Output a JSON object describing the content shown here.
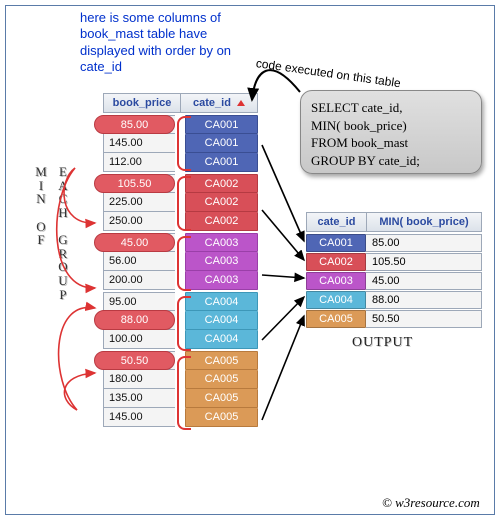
{
  "caption": "here is some columns of book_mast table have displayed with order by on cate_id",
  "curve_label": "code executed on this table",
  "sql": {
    "l1": "SELECT cate_id,",
    "l2": "MIN( book_price)",
    "l3": "FROM book_mast",
    "l4": "GROUP BY cate_id;"
  },
  "side_left": "MIN OF",
  "side_right": "EACH GROUP",
  "input_headers": {
    "book_price": "book_price",
    "cate_id": "cate_id"
  },
  "groups": [
    {
      "cate": "CA001",
      "rows": [
        {
          "price": "85.00",
          "min": true
        },
        {
          "price": "145.00",
          "min": false
        },
        {
          "price": "112.00",
          "min": false
        }
      ]
    },
    {
      "cate": "CA002",
      "rows": [
        {
          "price": "105.50",
          "min": true
        },
        {
          "price": "225.00",
          "min": false
        },
        {
          "price": "250.00",
          "min": false
        }
      ]
    },
    {
      "cate": "CA003",
      "rows": [
        {
          "price": "45.00",
          "min": true
        },
        {
          "price": "56.00",
          "min": false
        },
        {
          "price": "200.00",
          "min": false
        }
      ]
    },
    {
      "cate": "CA004",
      "rows": [
        {
          "price": "95.00",
          "min": false
        },
        {
          "price": "88.00",
          "min": true
        },
        {
          "price": "100.00",
          "min": false
        }
      ]
    },
    {
      "cate": "CA005",
      "rows": [
        {
          "price": "50.50",
          "min": true
        },
        {
          "price": "180.00",
          "min": false
        },
        {
          "price": "135.00",
          "min": false
        },
        {
          "price": "145.00",
          "min": false
        }
      ]
    }
  ],
  "output_headers": {
    "cate_id": "cate_id",
    "min": "MIN( book_price)"
  },
  "output_rows": [
    {
      "cate": "CA001",
      "val": "85.00"
    },
    {
      "cate": "CA002",
      "val": "105.50"
    },
    {
      "cate": "CA003",
      "val": "45.00"
    },
    {
      "cate": "CA004",
      "val": "88.00"
    },
    {
      "cate": "CA005",
      "val": "50.50"
    }
  ],
  "output_label": "OUTPUT",
  "copyright": "© w3resource.com"
}
